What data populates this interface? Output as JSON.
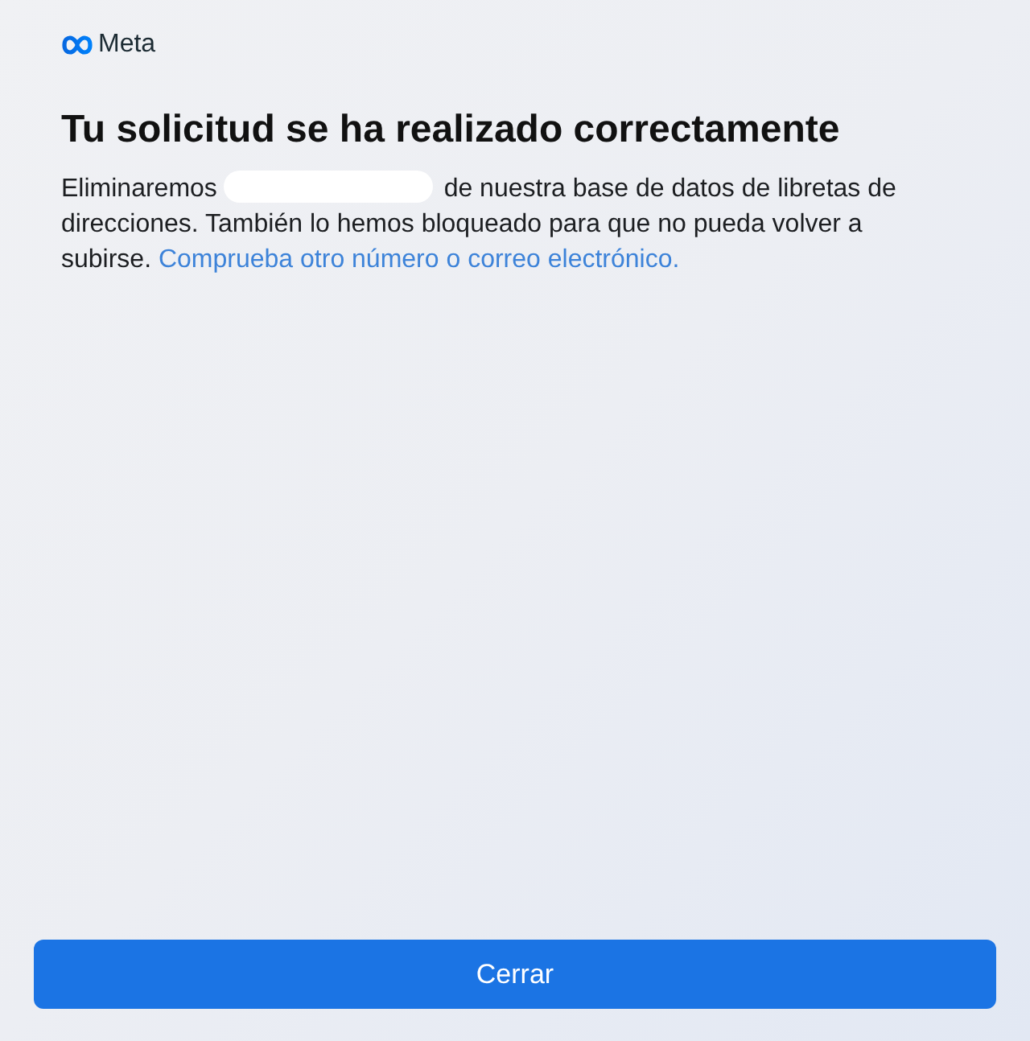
{
  "header": {
    "logo_text": "Meta"
  },
  "title": "Tu solicitud se ha realizado correctamente",
  "message": {
    "text_before": "Eliminaremos",
    "redacted": true,
    "text_after": "de nuestra base de datos de libretas de direcciones. También lo hemos bloqueado para que no pueda volver a subirse.",
    "link": "Comprueba otro número o correo electrónico."
  },
  "close_button": {
    "label": "Cerrar"
  }
}
